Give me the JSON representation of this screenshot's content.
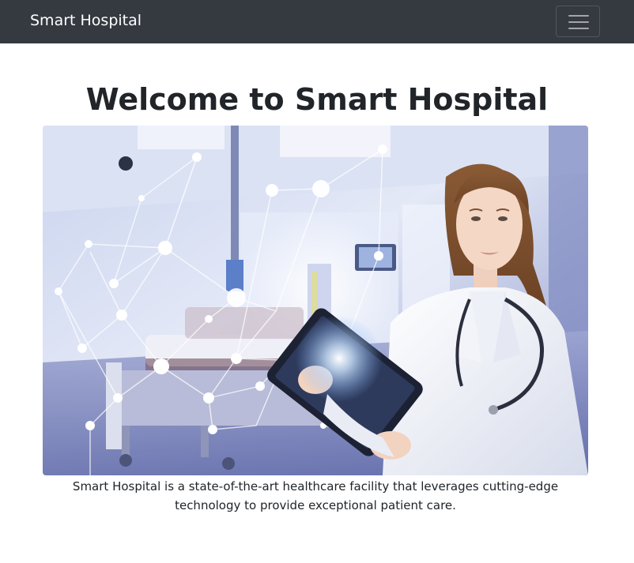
{
  "navbar": {
    "brand": "Smart Hospital",
    "toggle_icon": "hamburger-icon"
  },
  "main": {
    "title": "Welcome to Smart Hospital",
    "hero_image": "doctor-holding-tablet-in-hospital-room",
    "description": "Smart Hospital is a state-of-the-art healthcare facility that leverages cutting-edge technology to provide exceptional patient care."
  },
  "colors": {
    "navbar_bg": "#343a40",
    "text": "#212529",
    "background": "#ffffff"
  }
}
